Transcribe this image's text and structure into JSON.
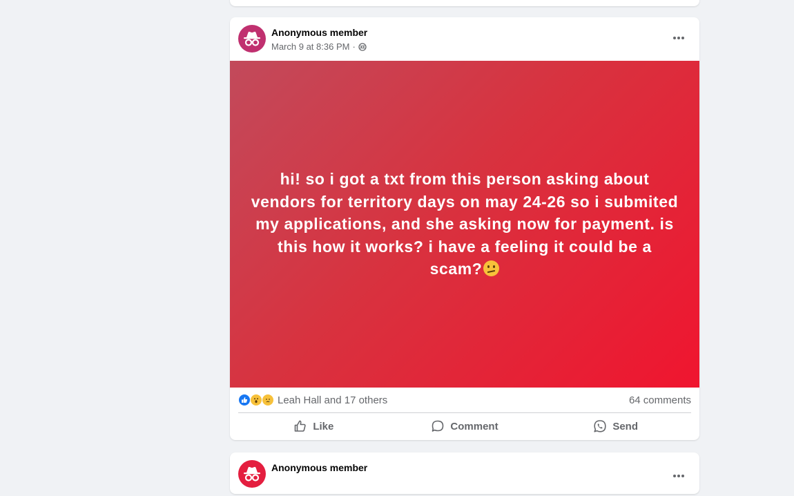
{
  "post": {
    "author": "Anonymous member",
    "timestamp": "March 9 at 8:36 PM",
    "separator": "·",
    "privacy_icon": "globe-icon",
    "body_text": "hi! so i got a txt from this person asking about vendors for territory days on may 24-26 so i submited my applications, and she asking now for payment. is this how it works? i have a feeling it could be a scam?",
    "body_emoji": "confused-face-emoji",
    "background_gradient": [
      "#c24a5b",
      "#f0152f"
    ],
    "reactions": [
      "like",
      "wow",
      "sad"
    ],
    "reactors_text": "Leah Hall and 17 others",
    "comments_text": "64 comments"
  },
  "actions": {
    "like_label": "Like",
    "comment_label": "Comment",
    "send_label": "Send"
  },
  "next_post": {
    "author": "Anonymous member"
  },
  "colors": {
    "accent": "#1877f2",
    "secondary_text": "#65676b",
    "page_bg": "#f0f2f5",
    "avatar": "#c0306f"
  }
}
